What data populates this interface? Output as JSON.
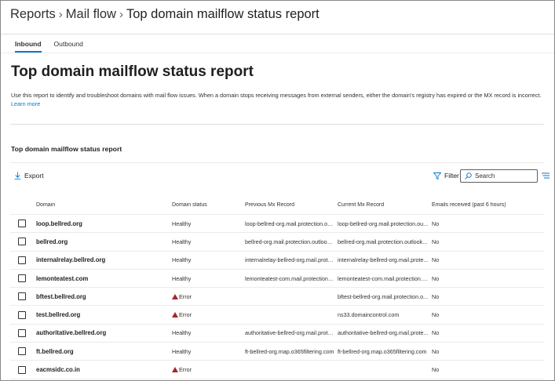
{
  "breadcrumb": {
    "items": [
      "Reports",
      "Mail flow",
      "Top domain mailflow status report"
    ]
  },
  "tabs": [
    {
      "label": "Inbound",
      "active": true
    },
    {
      "label": "Outbound",
      "active": false
    }
  ],
  "page": {
    "title": "Top domain mailflow status report",
    "description": "Use this report to identify and troubleshoot domains with mail flow issues. When a domain stops receiving messages from external senders, either the domain's registry has expired or the MX record is incorrect.",
    "learn_more": "Learn more"
  },
  "section": {
    "title": "Top domain mailflow status report"
  },
  "toolbar": {
    "export_label": "Export",
    "filter_label": "Filter",
    "search_placeholder": "Search"
  },
  "table": {
    "headers": [
      "Domain",
      "Domain status",
      "Previous Mx Record",
      "Current Mx Record",
      "Emails received (past 6 hours)"
    ],
    "rows": [
      {
        "domain": "loop.bellred.org",
        "status": "Healthy",
        "error": false,
        "prev": "loop-bellred-org.mail.protection.ou...",
        "curr": "loop-bellred-org.mail.protection.ou...",
        "emails": "No"
      },
      {
        "domain": "bellred.org",
        "status": "Healthy",
        "error": false,
        "prev": "bellred-org.mail.protection.outlook...",
        "curr": "bellred-org.mail.protection.outlook...",
        "emails": "No"
      },
      {
        "domain": "internalrelay.bellred.org",
        "status": "Healthy",
        "error": false,
        "prev": "internalrelay-bellred-org.mail.prote...",
        "curr": "internalrelay-bellred-org.mail.prote...",
        "emails": "No"
      },
      {
        "domain": "lemonteatest.com",
        "status": "Healthy",
        "error": false,
        "prev": "lemonteatest-com.mail.protection.o...",
        "curr": "lemonteatest-com.mail.protection.o...",
        "emails": "No"
      },
      {
        "domain": "bftest.bellred.org",
        "status": "Error",
        "error": true,
        "prev": "",
        "curr": "bftest-bellred-org.mail.protection.o...",
        "emails": "No"
      },
      {
        "domain": "test.bellred.org",
        "status": "Error",
        "error": true,
        "prev": "",
        "curr": "ns33.domaincontrol.com",
        "emails": "No"
      },
      {
        "domain": "authoritative.bellred.org",
        "status": "Healthy",
        "error": false,
        "prev": "authoritative-bellred-org.mail.prote...",
        "curr": "authoritative-bellred-org.mail.prote...",
        "emails": "No"
      },
      {
        "domain": "ft.bellred.org",
        "status": "Healthy",
        "error": false,
        "prev": "ft-bellred-org.map.o365filtering.com",
        "curr": "ft-bellred-org.map.o365filtering.com",
        "emails": "No"
      },
      {
        "domain": "eacmsidc.co.in",
        "status": "Error",
        "error": true,
        "prev": "",
        "curr": "",
        "emails": "No"
      }
    ]
  },
  "colors": {
    "accent": "#0078d4",
    "error": "#a4262c"
  },
  "icons": {
    "export": "download-icon",
    "filter": "filter-icon",
    "search": "search-icon",
    "menu": "list-options-icon",
    "error": "warning-icon"
  }
}
